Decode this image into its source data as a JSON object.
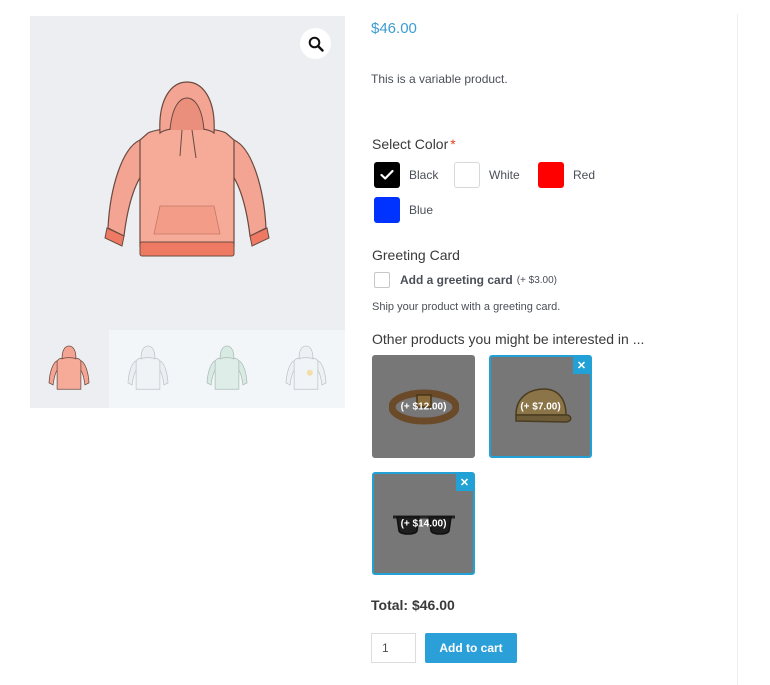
{
  "product": {
    "price": "$46.00",
    "short_description": "This is a variable product."
  },
  "gallery": {
    "zoom_icon": "search-icon",
    "thumbnails": [
      {
        "name": "hoodie-red",
        "color": "#f4a493"
      },
      {
        "name": "hoodie-white",
        "color": "#e3e8ec"
      },
      {
        "name": "hoodie-green",
        "color": "#b9dcc9"
      },
      {
        "name": "hoodie-logo",
        "color": "#e8ecef"
      }
    ]
  },
  "color_select": {
    "label": "Select Color",
    "required_mark": "*",
    "options": [
      {
        "label": "Black",
        "color": "#000000",
        "selected": true
      },
      {
        "label": "White",
        "color": "#ffffff",
        "selected": false
      },
      {
        "label": "Red",
        "color": "#ff0000",
        "selected": false
      },
      {
        "label": "Blue",
        "color": "#0033ff",
        "selected": false
      }
    ]
  },
  "greeting_card": {
    "title": "Greeting Card",
    "option_label": "Add a greeting card",
    "option_price": "(+ $3.00)",
    "checked": false,
    "note": "Ship your product with a greeting card."
  },
  "related": {
    "title": "Other products you might be interested in ...",
    "products": [
      {
        "name": "belt",
        "price": "(+ $12.00)",
        "selected": false
      },
      {
        "name": "cap",
        "price": "(+ $7.00)",
        "selected": true
      },
      {
        "name": "sunglasses",
        "price": "(+ $14.00)",
        "selected": true
      }
    ],
    "remove_glyph": "✕"
  },
  "cart": {
    "total": "Total: $46.00",
    "quantity": "1",
    "add_to_cart_label": "Add to cart"
  },
  "colors": {
    "accent": "#22a1d6",
    "price": "#3d9cd2",
    "required": "#e2401c"
  }
}
